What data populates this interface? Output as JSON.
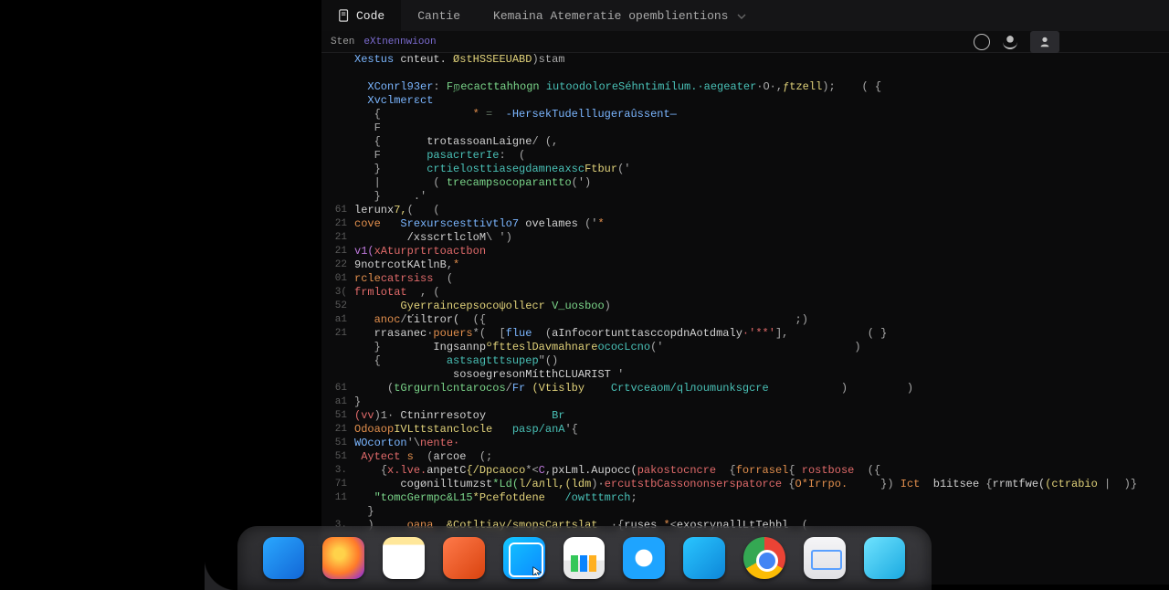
{
  "titlebar": {
    "tabs": [
      {
        "label": "Code",
        "active": true
      },
      {
        "label": "Cantie",
        "active": false
      },
      {
        "label": "Kemaina Atemeratie opemblientions",
        "active": false
      }
    ]
  },
  "searchbar": {
    "prefix": "Sten",
    "term": "eXtnennwioon"
  },
  "code_lines": [
    {
      "n": "",
      "html": "<span class='c-type'>Xestus</span> <span class='c-var'>cnteut.</span> <span class='c-fn'>ØstHSSEEUABD</span><span class='c-punct'>)stam</span>"
    },
    {
      "n": "",
      "html": ""
    },
    {
      "n": "",
      "html": "  <span class='c-type'>XConrl93er</span><span class='c-punct'>:</span> <span class='c-str'>Fறecacttahhogn</span> <span class='c-teal'>iutoodoloreSéhntimílum.·aegeater</span><span class='c-punct'>·O·,</span><span class='c-fn'>ƒtzell</span><span class='c-punct'>);    ( {</span>"
    },
    {
      "n": "",
      "html": "  <span class='c-type'>Xvclmerɛct</span>"
    },
    {
      "n": "",
      "html": "   <span class='c-punct'>{</span>              <span class='c-num'>*</span> <span class='c-comm'>=</span>  <span class='c-type'>-HersekTudelllugeraûssent—</span>"
    },
    {
      "n": "",
      "html": "   <span class='c-punct'>F</span>"
    },
    {
      "n": "",
      "html": "   <span class='c-punct'>{</span>       <span class='c-var'>trotassoanLaigne</span><span class='c-punct'>/ (,</span>"
    },
    {
      "n": "",
      "html": "   <span class='c-punct'>F</span>       <span class='c-teal'>pasacrterIe</span><span class='c-punct'>:  (</span>"
    },
    {
      "n": "",
      "html": "   <span class='c-punct'>}</span>       <span class='c-teal'>crtielosttiasegdamneaxsc</span><span class='c-fn'>Ftbur</span><span class='c-punct'>('</span>"
    },
    {
      "n": "",
      "html": "   <span class='c-punct'>|</span>        <span class='c-punct'>(</span> <span class='c-str'>trecampsocoparantto</span><span class='c-punct'>(')</span>"
    },
    {
      "n": "",
      "html": "   <span class='c-punct'>}     .'</span>"
    },
    {
      "n": "61",
      "html": "<span class='c-var'>lerunx</span><span class='c-fn'>7,</span><span class='c-punct'>(   (</span>"
    },
    {
      "n": "21",
      "html": "<span class='c-kw'>cove</span>   <span class='c-type'>Srexurscesttivtlo7</span> <span class='c-var'>ovelames</span> <span class='c-punct'>('</span><span class='c-kw'>*</span>"
    },
    {
      "n": "21",
      "html": "        <span class='c-var'>/xsscrtlcloM</span><span class='c-punct'>\\ ')</span>"
    },
    {
      "n": "21",
      "html": "<span class='c-prop'>v1(</span><span class='c-err'>xAturprtrtoactbon</span>"
    },
    {
      "n": "22",
      "html": "<span class='c-var'>9notrcotKAtlnB</span><span class='c-punct'>,</span><span class='c-kw'>*</span>"
    },
    {
      "n": "01",
      "html": "<span class='c-kw'>rcle</span><span class='c-err'>catrsiss</span>  <span class='c-punct'>(</span>"
    },
    {
      "n": "3(",
      "html": "<span class='c-err'>frmlotat</span>  <span class='c-punct'>, (</span>"
    },
    {
      "n": "52",
      "html": "       <span class='c-fn'>Gyerraincepsocoψollecr</span> <span class='c-str'>V_uosboo</span><span class='c-punct'>)</span>"
    },
    {
      "n": "a1",
      "html": "   <span class='c-kw'>anoc</span><span class='c-punct'>/</span><span class='c-var'>ťiltror(</span>  <span class='c-punct'>({</span>                                               <span class='c-punct'>;)</span>"
    },
    {
      "n": "21",
      "html": "   <span class='c-var'>rrasanec</span><span class='c-punct'>·</span><span class='c-kw'>pouers</span><span class='c-punct'>*(</span>  <span class='c-punct'>[</span><span class='c-type'>flue</span>  <span class='c-punct'>(</span><span class='c-var'>aInfocortunttasccopdnAotdmaly</span><span class='c-err'>·'**'</span><span class='c-punct'>],</span>            <span class='c-punct'>( }</span>"
    },
    {
      "n": "",
      "html": "   <span class='c-punct'>}</span>        <span class='c-var'>Ingsannp</span><span class='c-fn'>ºftteslDavmahnare</span><span class='c-teal'>ococLcno</span><span class='c-punct'>('</span>                             <span class='c-punct'>)</span>"
    },
    {
      "n": "",
      "html": "   <span class='c-punct'>{</span>          <span class='c-teal'>astsagtttsupep</span><span class='c-punct'>\"()</span>"
    },
    {
      "n": "",
      "html": "               <span class='c-var'>sosoegresonMítthCLUARISТ</span> <span class='c-punct'>'</span>"
    },
    {
      "n": "61",
      "html": "     <span class='c-punct'>(</span><span class='c-str'>tGrgurnlcntarocos</span><span class='c-punct'>/</span><span class='c-type'>Fr</span> <span class='c-fn'>(Vtislby</span>    <span class='c-teal'>Crtvceaom/qlлoumunksgcre</span>           <span class='c-punct'>)         )</span>"
    },
    {
      "n": "a1",
      "html": "<span class='c-punct'>}</span>"
    },
    {
      "n": "51",
      "html": "<span class='c-err'>(vv</span><span class='c-punct'>)1·</span> <span class='c-var'>Ctninrresotoy</span>          <span class='c-teal'>Br</span>"
    },
    {
      "n": "21",
      "html": "<span class='c-kw'>Odoaop</span><span class='c-fn'>IVLttstanclocle</span>   <span class='c-teal'>pasp/anA</span><span class='c-punct'>'{</span>"
    },
    {
      "n": "51",
      "html": "<span class='c-type'>WOcorton</span><span class='c-punct'>'\\</span><span class='c-err'>nente·</span>"
    },
    {
      "n": "51",
      "html": " <span class='c-err'>Aytect</span> <span class='c-kw'>s</span>  <span class='c-punct'>(</span><span class='c-var'>arcoe</span>  <span class='c-punct'>(;</span>"
    },
    {
      "n": "3.",
      "html": "    <span class='c-punct'>{</span><span class='c-err'>x.lve.</span><span class='c-var'>anpetC</span><span class='c-fn'>{/Dpcaoco</span><span class='c-punct'>*<</span><span class='c-prop'>C</span><span class='c-punct'>,</span><span class='c-var'>pxLml.Aupocc(</span><span class='c-err'>pakostocncre</span>  <span class='c-punct'>{</span><span class='c-kw'>forrasel</span><span class='c-punct'>{</span> <span class='c-err'>rostbose</span>  <span class='c-punct'>({</span>"
    },
    {
      "n": "71",
      "html": "       <span class='c-var'>cogønilltumzst</span><span class='c-str'>*Ld(</span><span class='c-fn'>l/aлll,(ldm</span><span class='c-punct'>)·</span><span class='c-err'>ercutstbCassononserspatorce</span> <span class='c-punct'>{</span><span class='c-kw'>O*Irrpo.</span>     <span class='c-punct'>})</span> <span class='c-kw'>Ict</span>  <span class='c-var'>b1itsee</span> <span class='c-punct'>{</span><span class='c-var'>rrmtfwe(</span><span class='c-fn'>(ctrabio</span> <span class='c-punct'>|  )}</span>"
    },
    {
      "n": "11",
      "html": "   <span class='c-str'>\"tomcGermpc&L15</span><span class='c-fn'>*Pcefotdene</span>   <span class='c-teal'>/owtttmrch</span><span class='c-punct'>;</span>"
    },
    {
      "n": "",
      "html": "  <span class='c-punct'>}</span>"
    },
    {
      "n": "3.",
      "html": "  <span class='c-punct'>)</span>     <span class='c-kw'>oana</span>  <span class='c-fn'>&Cotltiay/smopsCartslat</span>  <span class='c-punct'>·{</span><span class='c-var'>ruses</span> <span class='c-kw'>*</span><span class='c-punct'><</span><span class='c-var'>exosrynallLtTehbl</span>  <span class='c-punct'>(</span>"
    },
    {
      "n": "",
      "html": ""
    },
    {
      "n": "",
      "html": "<span class='c-punct'>)</span>"
    }
  ],
  "dock": [
    {
      "name": "finder"
    },
    {
      "name": "firefox"
    },
    {
      "name": "notes"
    },
    {
      "name": "ppt"
    },
    {
      "name": "xcode"
    },
    {
      "name": "numbers"
    },
    {
      "name": "safari"
    },
    {
      "name": "skype"
    },
    {
      "name": "chrome"
    },
    {
      "name": "mail"
    },
    {
      "name": "msg"
    }
  ]
}
